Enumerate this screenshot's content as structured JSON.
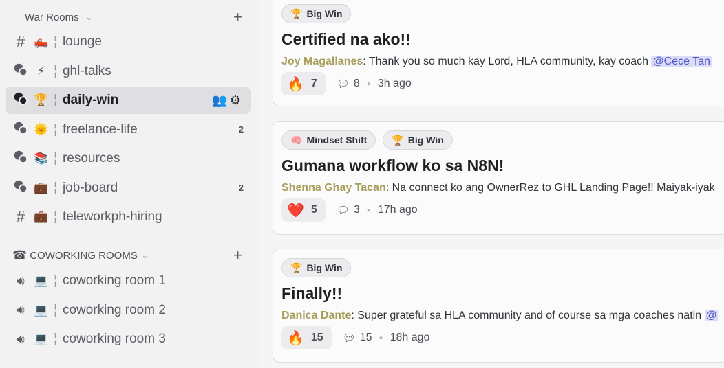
{
  "sidebar": {
    "war_rooms": {
      "label": "War Rooms",
      "add": "+",
      "chevron": "⌄"
    },
    "channels": [
      {
        "icon": "#",
        "emoji": "🛻",
        "name": "lounge",
        "type": "text"
      },
      {
        "icon": "forum",
        "emoji": "⚡",
        "name": "ghl-talks",
        "type": "forum"
      },
      {
        "icon": "forum",
        "emoji": "🏆",
        "name": "daily-win",
        "type": "forum",
        "active": true
      },
      {
        "icon": "forum",
        "emoji": "🌞",
        "name": "freelance-life",
        "type": "forum",
        "badge": "2"
      },
      {
        "icon": "forum",
        "emoji": "📚",
        "name": "resources",
        "type": "forum"
      },
      {
        "icon": "forum",
        "emoji": "💼",
        "name": "job-board",
        "type": "forum",
        "badge": "2"
      },
      {
        "icon": "#",
        "emoji": "💼",
        "name": "teleworkph-hiring",
        "type": "text"
      }
    ],
    "coworking": {
      "label": "COWORKING ROOMS",
      "icon": "☎",
      "add": "+",
      "chevron": "⌄"
    },
    "voice": [
      {
        "emoji": "💻",
        "name": "coworking room 1"
      },
      {
        "emoji": "💻",
        "name": "coworking room 2"
      },
      {
        "emoji": "💻",
        "name": "coworking room 3"
      }
    ],
    "separator": "¦"
  },
  "posts": [
    {
      "tags": [
        {
          "emoji": "🏆",
          "label": "Big Win"
        }
      ],
      "title": "Certified na ako!!",
      "author": "Joy Magallanes",
      "text": ": Thank you so much kay Lord, HLA community, kay coach ",
      "mention": "@Cece Tan",
      "reaction": "🔥",
      "reaction_count": "7",
      "comments": "8",
      "time": "3h ago"
    },
    {
      "tags": [
        {
          "emoji": "🧠",
          "label": "Mindset Shift"
        },
        {
          "emoji": "🏆",
          "label": "Big Win"
        }
      ],
      "title": "Gumana workflow ko sa N8N!",
      "author": "Shenna Ghay Tacan",
      "text": ": Na connect ko ang OwnerRez to GHL Landing Page!! Maiyak-iyak",
      "mention": "",
      "reaction": "❤️",
      "reaction_count": "5",
      "comments": "3",
      "time": "17h ago"
    },
    {
      "tags": [
        {
          "emoji": "🏆",
          "label": "Big Win"
        }
      ],
      "title": "Finally!!",
      "author": "Danica Dante",
      "text": ": Super grateful sa HLA community and of course sa mga coaches natin ",
      "mention": "@",
      "reaction": "🔥",
      "reaction_count": "15",
      "comments": "15",
      "time": "18h ago"
    }
  ]
}
